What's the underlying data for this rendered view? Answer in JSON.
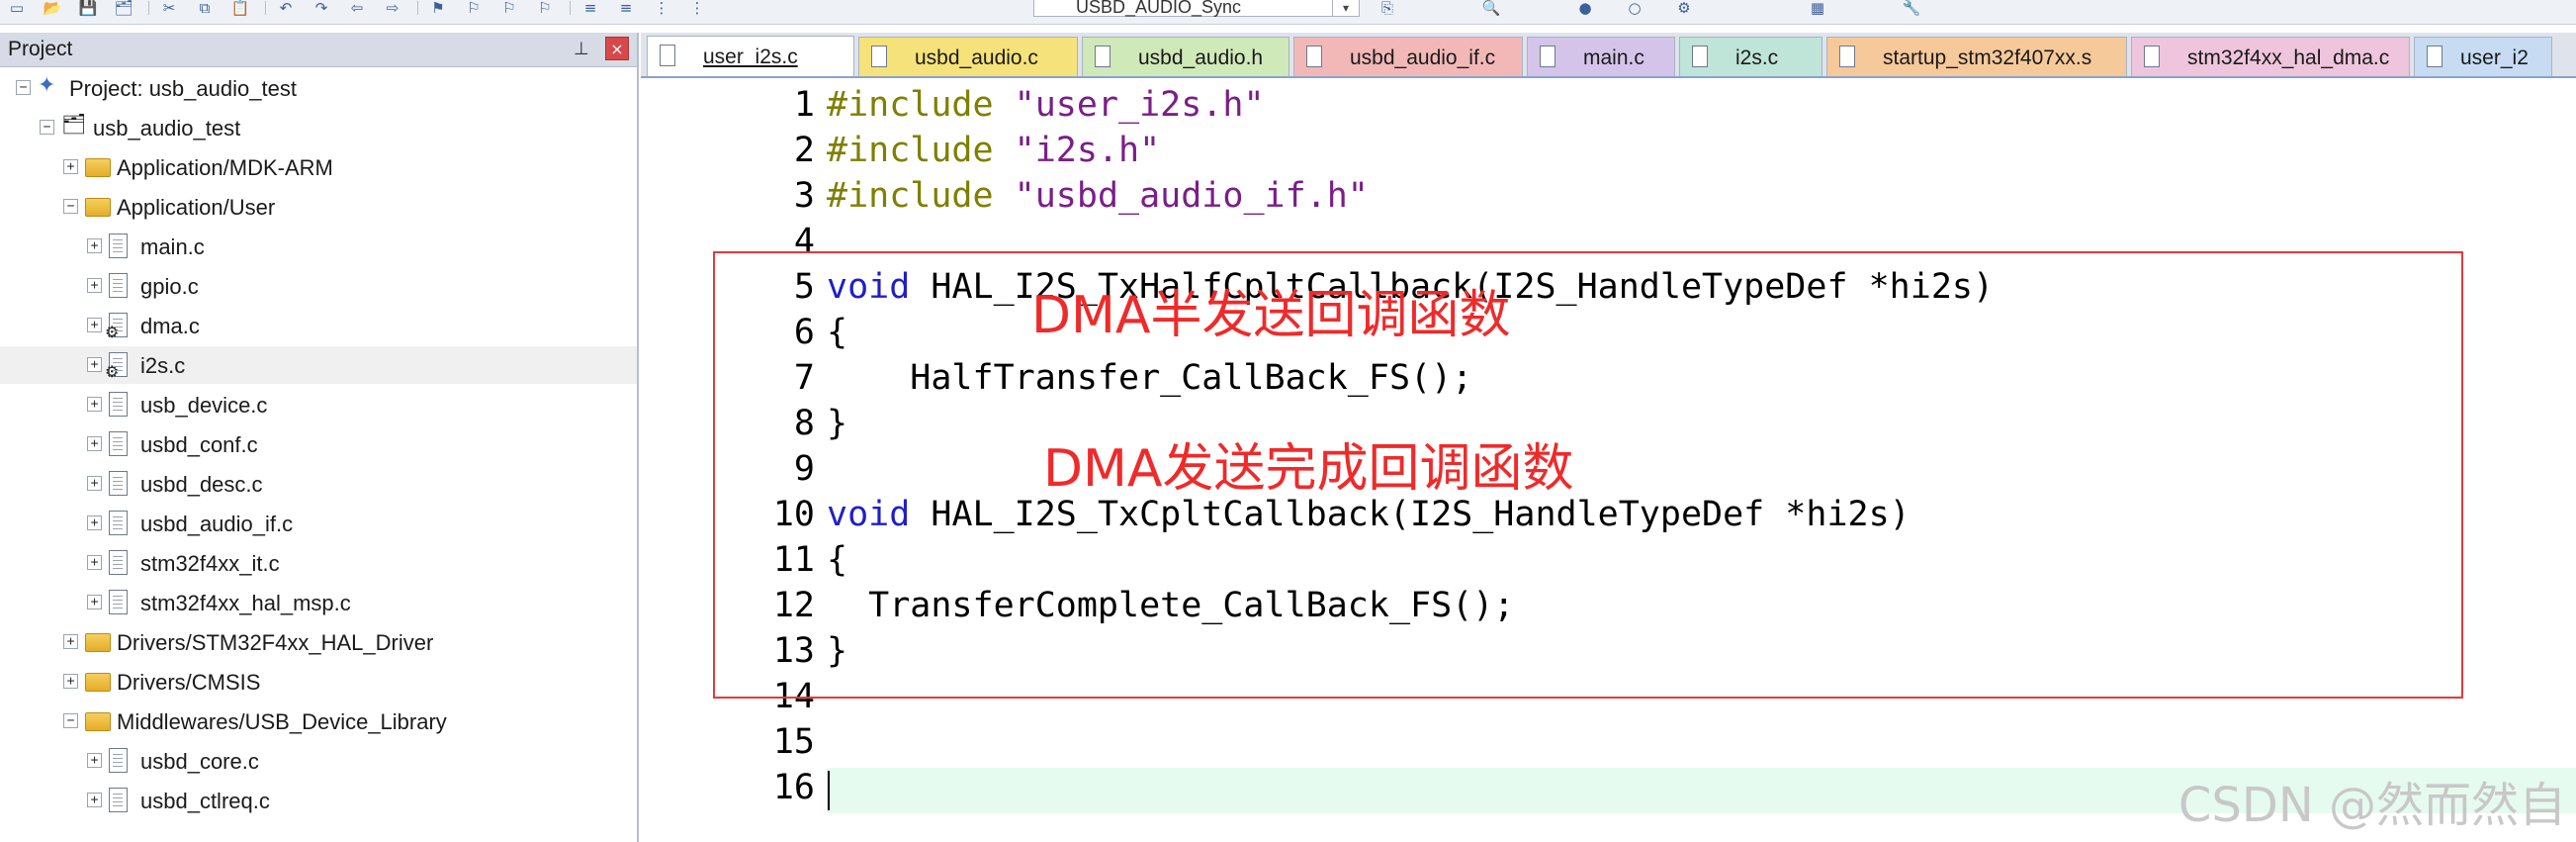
{
  "toolbar": {
    "icons": [
      "new-file-icon",
      "open-icon",
      "save-icon",
      "save-all-icon",
      "cut-icon",
      "copy-icon",
      "paste-icon",
      "undo-icon",
      "redo-icon",
      "back-icon",
      "forward-icon",
      "bookmark-icon",
      "prev-bookmark-icon",
      "next-bookmark-icon",
      "clear-bookmarks-icon",
      "indent-icon",
      "unindent-icon",
      "comment-icon",
      "uncomment-icon"
    ],
    "target_name": "USBD_AUDIO_Sync"
  },
  "project_pane": {
    "title": "Project",
    "pin_glyph": "⊥",
    "close_glyph": "×",
    "project_label": "Project: usb_audio_test",
    "target_label": "usb_audio_test",
    "groups": [
      {
        "label": "Application/MDK-ARM",
        "expanded": false
      },
      {
        "label": "Application/User",
        "expanded": true,
        "files": [
          "main.c",
          "gpio.c",
          "dma.c",
          "i2s.c",
          "usb_device.c",
          "usbd_conf.c",
          "usbd_desc.c",
          "usbd_audio_if.c",
          "stm32f4xx_it.c",
          "stm32f4xx_hal_msp.c"
        ]
      },
      {
        "label": "Drivers/STM32F4xx_HAL_Driver",
        "expanded": false
      },
      {
        "label": "Drivers/CMSIS",
        "expanded": false
      },
      {
        "label": "Middlewares/USB_Device_Library",
        "expanded": true,
        "files": [
          "usbd_core.c",
          "usbd_ctlreq.c"
        ]
      }
    ],
    "selected_file": "i2s.c"
  },
  "tabs": [
    {
      "label": "user_i2s.c",
      "color": "#ffffff",
      "active": true
    },
    {
      "label": "usbd_audio.c",
      "color": "#f5e27a",
      "active": false
    },
    {
      "label": "usbd_audio.h",
      "color": "#cfe9b8",
      "active": false
    },
    {
      "label": "usbd_audio_if.c",
      "color": "#f2b8b8",
      "active": false
    },
    {
      "label": "main.c",
      "color": "#d4c4ea",
      "active": false
    },
    {
      "label": "i2s.c",
      "color": "#bfe4d8",
      "active": false
    },
    {
      "label": "startup_stm32f407xx.s",
      "color": "#f6c99a",
      "active": false
    },
    {
      "label": "stm32f4xx_hal_dma.c",
      "color": "#eec5dd",
      "active": false
    },
    {
      "label": "user_i2",
      "color": "#c7dcf3",
      "active": false
    }
  ],
  "editor": {
    "lines": [
      {
        "n": "1",
        "tokens": [
          {
            "t": "#include ",
            "c": "kw-inc"
          },
          {
            "t": "\"user_i2s.h\"",
            "c": "str"
          }
        ]
      },
      {
        "n": "2",
        "tokens": [
          {
            "t": "#include ",
            "c": "kw-inc"
          },
          {
            "t": "\"i2s.h\"",
            "c": "str"
          }
        ]
      },
      {
        "n": "3",
        "tokens": [
          {
            "t": "#include ",
            "c": "kw-inc"
          },
          {
            "t": "\"usbd_audio_if.h\"",
            "c": "str"
          }
        ]
      },
      {
        "n": "4",
        "tokens": []
      },
      {
        "n": "5",
        "tokens": [
          {
            "t": "void",
            "c": "kw"
          },
          {
            "t": " HAL_I2S_TxHalfCpltCallback(I2S_HandleTypeDef *hi2s)",
            "c": ""
          }
        ]
      },
      {
        "n": "6",
        "tokens": [
          {
            "t": "{",
            "c": ""
          }
        ]
      },
      {
        "n": "7",
        "tokens": [
          {
            "t": "    HalfTransfer_CallBack_FS();",
            "c": ""
          }
        ]
      },
      {
        "n": "8",
        "tokens": [
          {
            "t": "}",
            "c": ""
          }
        ]
      },
      {
        "n": "9",
        "tokens": []
      },
      {
        "n": "10",
        "tokens": [
          {
            "t": "void",
            "c": "kw"
          },
          {
            "t": " HAL_I2S_TxCpltCallback(I2S_HandleTypeDef *hi2s)",
            "c": ""
          }
        ]
      },
      {
        "n": "11",
        "tokens": [
          {
            "t": "{",
            "c": ""
          }
        ]
      },
      {
        "n": "12",
        "tokens": [
          {
            "t": "  TransferComplete_CallBack_FS();",
            "c": ""
          }
        ]
      },
      {
        "n": "13",
        "tokens": [
          {
            "t": "}",
            "c": ""
          }
        ]
      },
      {
        "n": "14",
        "tokens": []
      },
      {
        "n": "15",
        "tokens": []
      },
      {
        "n": "16",
        "tokens": []
      }
    ],
    "annotations": {
      "half": "DMA半发送回调函数",
      "complete": "DMA发送完成回调函数",
      "color": "#ef2a2a"
    },
    "watermark": "CSDN @然而然自"
  }
}
